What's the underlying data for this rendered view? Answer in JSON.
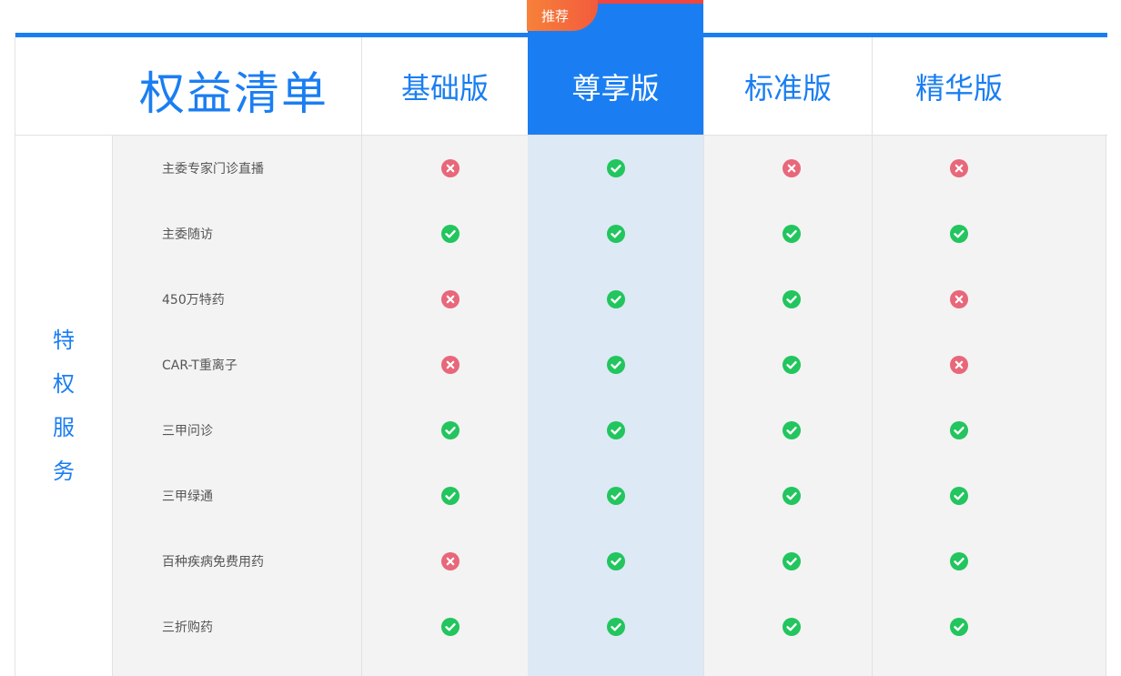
{
  "title": "权益清单",
  "badge": "推荐",
  "category": [
    "特",
    "权",
    "服",
    "务"
  ],
  "plans": [
    {
      "name": "基础版",
      "featured": false
    },
    {
      "name": "尊享版",
      "featured": true
    },
    {
      "name": "标准版",
      "featured": false
    },
    {
      "name": "精华版",
      "featured": false
    }
  ],
  "features": [
    {
      "label": "主委专家门诊直播",
      "values": [
        false,
        true,
        false,
        false
      ]
    },
    {
      "label": "主委随访",
      "values": [
        true,
        true,
        true,
        true
      ]
    },
    {
      "label": "450万特药",
      "values": [
        false,
        true,
        true,
        false
      ]
    },
    {
      "label": "CAR-T重离子",
      "values": [
        false,
        true,
        true,
        false
      ]
    },
    {
      "label": "三甲问诊",
      "values": [
        true,
        true,
        true,
        true
      ]
    },
    {
      "label": "三甲绿通",
      "values": [
        true,
        true,
        true,
        true
      ]
    },
    {
      "label": "百种疾病免费用药",
      "values": [
        false,
        true,
        true,
        true
      ]
    },
    {
      "label": "三折购药",
      "values": [
        true,
        true,
        true,
        true
      ]
    }
  ],
  "colors": {
    "accent": "#1a7ef2",
    "check": "#22c55e",
    "cross": "#e8677a"
  },
  "icons": {
    "check": "check-circle-icon",
    "cross": "x-circle-icon"
  }
}
